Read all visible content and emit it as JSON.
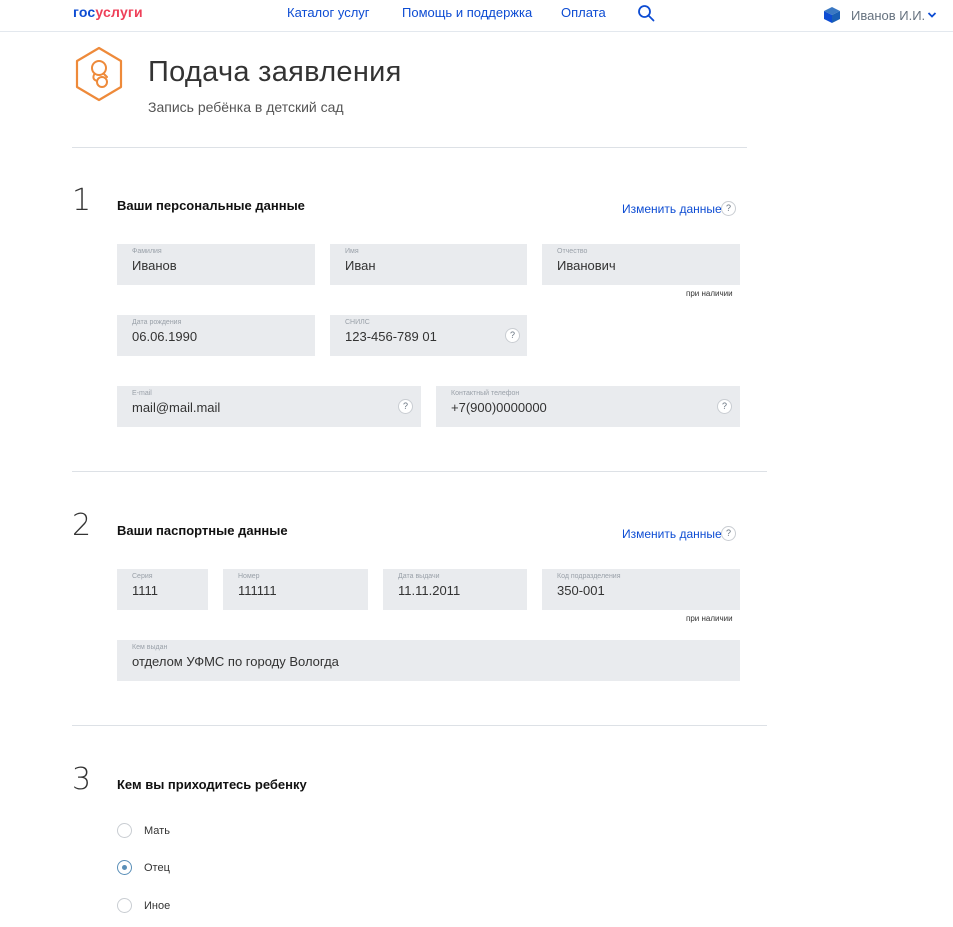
{
  "header": {
    "logo_part1": "гос",
    "logo_part2": "услуги",
    "nav": [
      "Каталог услуг",
      "Помощь и поддержка",
      "Оплата"
    ],
    "user_name": "Иванов И.И."
  },
  "page": {
    "title": "Подача заявления",
    "subtitle": "Запись ребёнка в детский сад"
  },
  "section1": {
    "number": "1",
    "title": "Ваши персональные данные",
    "change_link": "Изменить данные",
    "fields": {
      "last_name": {
        "label": "Фамилия",
        "value": "Иванов"
      },
      "first_name": {
        "label": "Имя",
        "value": "Иван"
      },
      "patronymic": {
        "label": "Отчество",
        "value": "Иванович"
      },
      "birth_date": {
        "label": "Дата рождения",
        "value": "06.06.1990"
      },
      "snils": {
        "label": "СНИЛС",
        "value": "123-456-789 01"
      },
      "email": {
        "label": "E-mail",
        "value": "mail@mail.mail"
      },
      "phone": {
        "label": "Контактный телефон",
        "value": "+7(900)0000000"
      }
    },
    "note": "при наличии"
  },
  "section2": {
    "number": "2",
    "title": "Ваши паспортные данные",
    "change_link": "Изменить данные",
    "fields": {
      "series": {
        "label": "Серия",
        "value": "1111"
      },
      "number": {
        "label": "Номер",
        "value": "111111"
      },
      "issue_date": {
        "label": "Дата выдачи",
        "value": "11.11.2011"
      },
      "dept_code": {
        "label": "Код подразделения",
        "value": "350-001"
      },
      "issued_by": {
        "label": "Кем выдан",
        "value": "отделом УФМС по городу Вологда"
      }
    },
    "note": "при наличии"
  },
  "section3": {
    "number": "3",
    "title": "Кем вы приходитесь ребенку",
    "options": [
      "Мать",
      "Отец",
      "Иное"
    ],
    "selected": "Отец"
  },
  "help_mark": "?",
  "colors": {
    "link": "#0d4cd3",
    "logo_red": "#ee3f58",
    "field_bg": "#e9ebee",
    "icon_orange": "#ee8a3a"
  }
}
